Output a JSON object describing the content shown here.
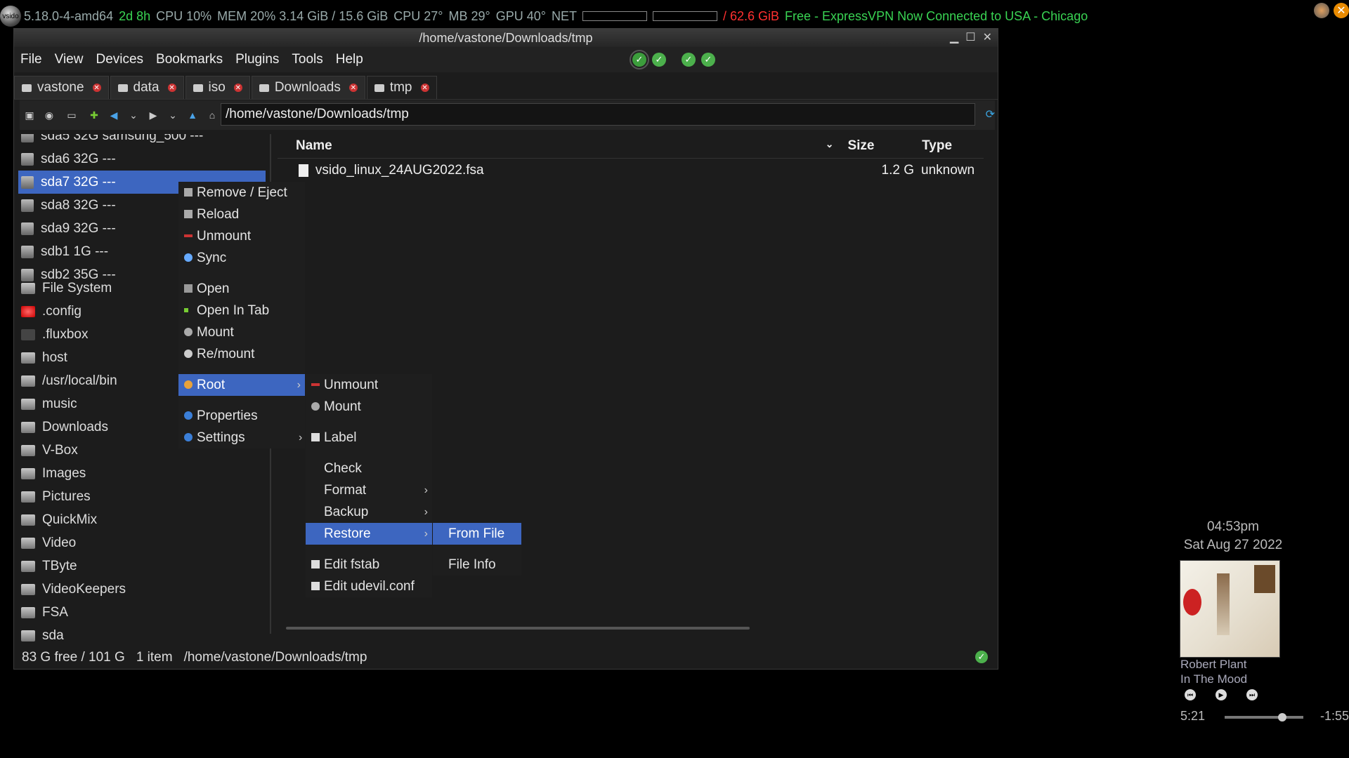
{
  "conky": {
    "distro": "vsido",
    "kernel": "5.18.0-4-amd64",
    "uptime": "2d 8h",
    "cpu": "CPU 10%",
    "mem": "MEM 20% 3.14 GiB / 15.6 GiB",
    "cpu_temp": "CPU 27°",
    "mb_temp": "MB 29°",
    "gpu_temp": "GPU 40°",
    "net": "NET",
    "disk": "/ 62.6 GiB",
    "free_vpn": "Free - ExpressVPN Now Connected to USA - Chicago"
  },
  "window": {
    "title": "/home/vastone/Downloads/tmp",
    "menu": [
      "File",
      "View",
      "Devices",
      "Bookmarks",
      "Plugins",
      "Tools",
      "Help"
    ],
    "tabs": [
      {
        "label": "vastone"
      },
      {
        "label": "data"
      },
      {
        "label": "iso"
      },
      {
        "label": "Downloads"
      },
      {
        "label": "tmp"
      }
    ],
    "path": "/home/vastone/Downloads/tmp"
  },
  "devices": [
    {
      "label": "sda5 32G samsung_500 ---"
    },
    {
      "label": "sda6 32G ---"
    },
    {
      "label": "sda7 32G ---"
    },
    {
      "label": "sda8 32G ---"
    },
    {
      "label": "sda9 32G ---"
    },
    {
      "label": "sdb1 1G ---"
    },
    {
      "label": "sdb2 35G ---"
    }
  ],
  "bookmarks": [
    {
      "label": "File System"
    },
    {
      "label": ".config"
    },
    {
      "label": ".fluxbox"
    },
    {
      "label": "host"
    },
    {
      "label": "/usr/local/bin"
    },
    {
      "label": "music"
    },
    {
      "label": "Downloads"
    },
    {
      "label": "V-Box"
    },
    {
      "label": "Images"
    },
    {
      "label": "Pictures"
    },
    {
      "label": "QuickMix"
    },
    {
      "label": "Video"
    },
    {
      "label": "TByte"
    },
    {
      "label": "VideoKeepers"
    },
    {
      "label": "FSA"
    },
    {
      "label": "sda"
    }
  ],
  "filelist": {
    "headers": {
      "name": "Name",
      "size": "Size",
      "type": "Type"
    },
    "rows": [
      {
        "name": "vsido_linux_24AUG2022.fsa",
        "size": "1.2 G",
        "type": "unknown"
      }
    ]
  },
  "status": {
    "free": "83 G free / 101 G",
    "count": "1 item",
    "path": "/home/vastone/Downloads/tmp"
  },
  "context_menu": {
    "items": [
      "Remove / Eject",
      "Reload",
      "Unmount",
      "Sync",
      "Open",
      "Open In Tab",
      "Mount",
      "Re/mount",
      "Root",
      "Properties",
      "Settings"
    ]
  },
  "root_submenu": {
    "items": [
      "Unmount",
      "Mount",
      "Label",
      "Check",
      "Format",
      "Backup",
      "Restore",
      "Edit fstab",
      "Edit udevil.conf"
    ]
  },
  "restore_submenu": {
    "items": [
      "From File",
      "File Info"
    ]
  },
  "clock": {
    "time": "04:53pm",
    "date": "Sat Aug 27 2022"
  },
  "music": {
    "artist": "Robert Plant",
    "album": "In The Mood",
    "elapsed": "5:21",
    "remaining": "-1:55",
    "progress": 0.73
  }
}
